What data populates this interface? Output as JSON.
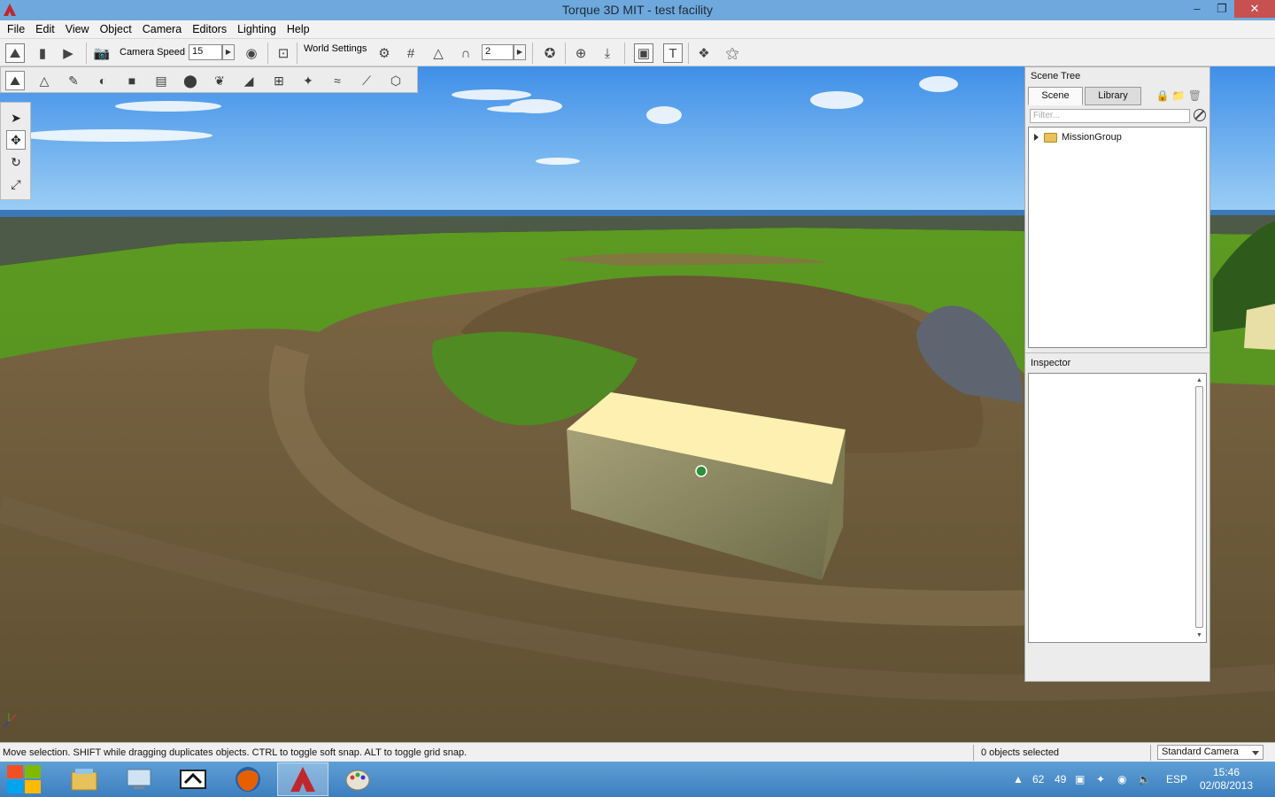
{
  "window": {
    "title": "Torque 3D MIT - test facility",
    "minimize": "–",
    "restore": "❐",
    "close": "✕"
  },
  "menu": [
    "File",
    "Edit",
    "View",
    "Object",
    "Camera",
    "Editors",
    "Lighting",
    "Help"
  ],
  "toolbar": {
    "camera_speed_label": "Camera Speed",
    "camera_speed_value": "15",
    "world_settings_label": "World Settings",
    "snap_value": "2"
  },
  "scene_tree": {
    "title": "Scene Tree",
    "tabs": [
      "Scene",
      "Library"
    ],
    "filter_placeholder": "Filter...",
    "items": [
      "MissionGroup"
    ]
  },
  "inspector": {
    "title": "Inspector"
  },
  "status": {
    "message": "Move selection.  SHIFT while dragging duplicates objects.  CTRL to toggle soft snap.  ALT to toggle grid snap.",
    "selection": "0 objects selected",
    "camera": "Standard Camera"
  },
  "taskbar": {
    "tray_numbers": [
      "62",
      "49"
    ],
    "language": "ESP",
    "time": "15:46",
    "date": "02/08/2013"
  }
}
